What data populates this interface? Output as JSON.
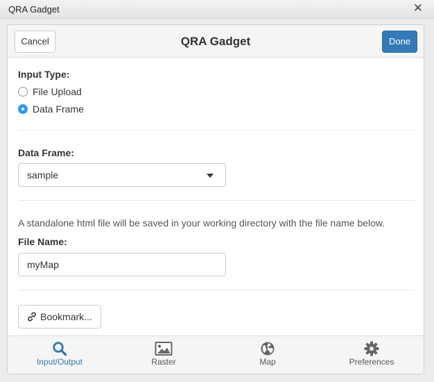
{
  "window": {
    "title": "QRA Gadget",
    "close_glyph": "✕"
  },
  "gadget": {
    "title": "QRA Gadget",
    "cancel_label": "Cancel",
    "done_label": "Done"
  },
  "input_type": {
    "label": "Input Type:",
    "options": [
      {
        "label": "File Upload",
        "checked": false
      },
      {
        "label": "Data Frame",
        "checked": true
      }
    ]
  },
  "data_frame": {
    "label": "Data Frame:",
    "selected": "sample"
  },
  "file": {
    "help_text": "A standalone html file will be saved in your working directory with the file name below.",
    "label": "File Name:",
    "value": "myMap"
  },
  "bookmark": {
    "label": "Bookmark..."
  },
  "tabs": [
    {
      "label": "Input/Output",
      "icon": "search-icon",
      "active": true
    },
    {
      "label": "Raster",
      "icon": "image-icon",
      "active": false
    },
    {
      "label": "Map",
      "icon": "globe-icon",
      "active": false
    },
    {
      "label": "Preferences",
      "icon": "gear-icon",
      "active": false
    }
  ],
  "colors": {
    "accent": "#337ab7",
    "radio_checked": "#2f9bf0"
  }
}
